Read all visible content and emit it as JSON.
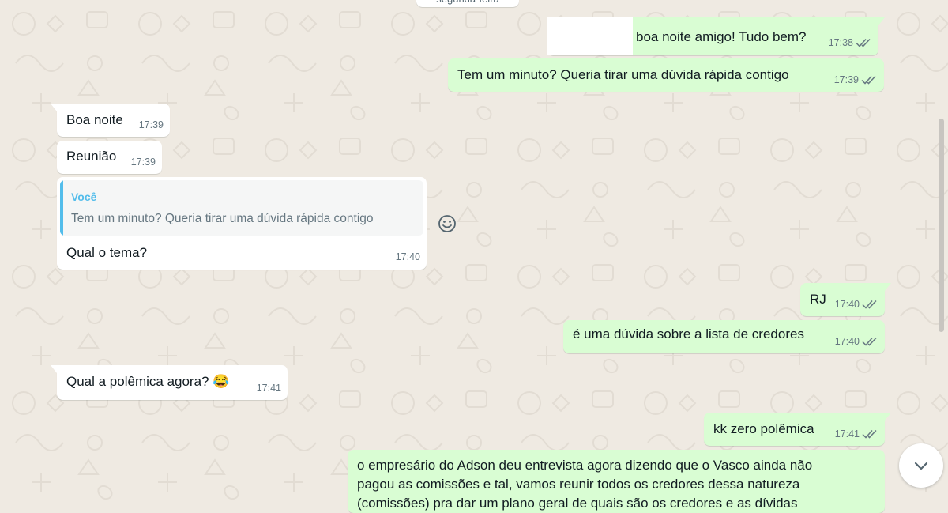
{
  "date_pill": "segunda-feira",
  "messages": [
    {
      "text": "boa noite amigo! Tudo bem?",
      "time": "17:38"
    },
    {
      "text": "Tem um minuto? Queria tirar uma dúvida rápida contigo",
      "time": "17:39"
    },
    {
      "text": "Boa noite",
      "time": "17:39"
    },
    {
      "text": "Reunião",
      "time": "17:39"
    },
    {
      "quote_author": "Você",
      "quote_text": "Tem um minuto? Queria tirar uma dúvida rápida contigo",
      "text": "Qual o tema?",
      "time": "17:40"
    },
    {
      "text": "RJ",
      "time": "17:40"
    },
    {
      "text": "é uma dúvida sobre a lista de credores",
      "time": "17:40"
    },
    {
      "text": "Qual a polêmica agora?",
      "emoji": "😂",
      "time": "17:41"
    },
    {
      "text": "kk zero polêmica",
      "time": "17:41"
    },
    {
      "lines": [
        "o empresário do Adson deu entrevista agora dizendo que o Vasco ainda não",
        "pagou as comissões e tal, vamos reunir todos os credores dessa natureza",
        "(comissões) pra dar um plano geral de quais são os credores e as dívidas"
      ]
    }
  ],
  "icons": {
    "read_receipt": "double-check-icon",
    "react": "smiley-icon",
    "scroll_down": "chevron-down-icon"
  },
  "colors": {
    "wallpaper": "#efeae2",
    "outgoing": "#d9fdd3",
    "incoming": "#ffffff",
    "read_ticks": "#667781",
    "quote_accent": "#53bdeb"
  }
}
